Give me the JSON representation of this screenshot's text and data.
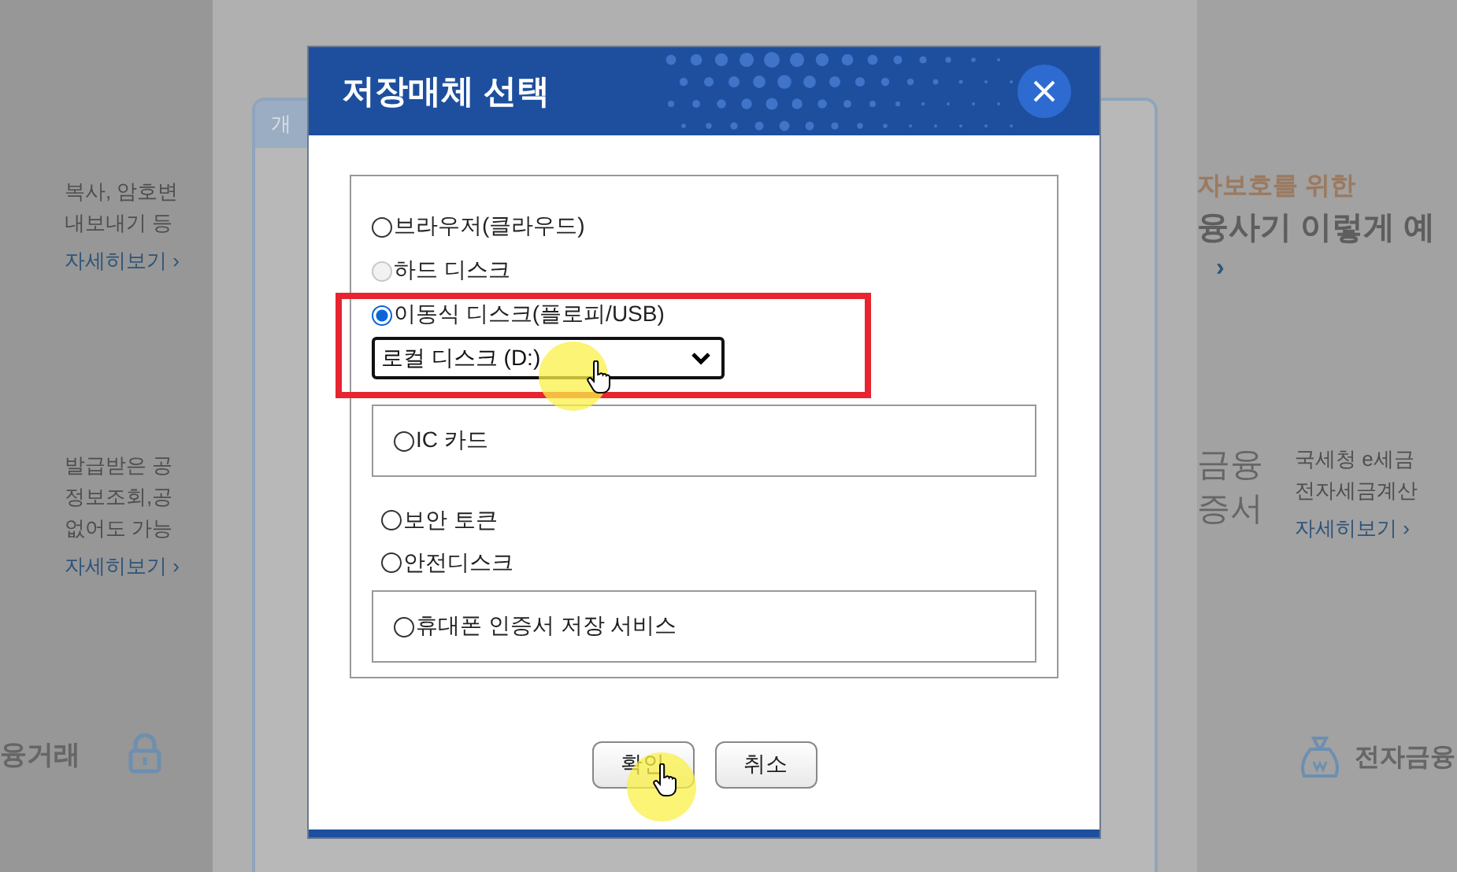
{
  "background": {
    "left_sections": [
      {
        "lines": [
          "복사, 암호변",
          "내보내기 등"
        ],
        "link": "자세히보기 ›"
      },
      {
        "lines": [
          "발급받은 공",
          "정보조회,공",
          "없어도 가능"
        ],
        "link": "자세히보기 ›"
      }
    ],
    "left_footer": "융거래",
    "tab": "개",
    "right_top": {
      "subtitle": "자보호를 위한",
      "headline": "융사기 이렇게 예",
      "link": "› "
    },
    "right_middle": {
      "title_lines": [
        "금융",
        "증서"
      ],
      "lines": [
        "국세청 e세금",
        "전자세금계산"
      ],
      "link": "자세히보기 ›"
    },
    "right_footer": "전자금융"
  },
  "dialog": {
    "title": "저장매체 선택",
    "options": [
      {
        "label": "브라우저(클라우드)",
        "kind": "plain",
        "selected": false,
        "disabled": false,
        "highlighted": false
      },
      {
        "label": "하드 디스크",
        "kind": "plain",
        "selected": false,
        "disabled": true,
        "highlighted": false
      },
      {
        "label": "이동식 디스크(플로피/USB)",
        "kind": "dropdown",
        "selected": true,
        "disabled": false,
        "highlighted": true,
        "value": "로컬 디스크 (D:)"
      },
      {
        "label": "IC 카드",
        "kind": "boxed",
        "selected": false,
        "disabled": false,
        "highlighted": false
      },
      {
        "label": "보안 토큰",
        "kind": "plain",
        "selected": false,
        "disabled": false,
        "highlighted": false
      },
      {
        "label": "안전디스크",
        "kind": "plain",
        "selected": false,
        "disabled": false,
        "highlighted": false
      },
      {
        "label": "휴대폰 인증서 저장 서비스",
        "kind": "boxed",
        "selected": false,
        "disabled": false,
        "highlighted": false
      }
    ],
    "buttons": [
      "확인",
      "취소"
    ]
  }
}
